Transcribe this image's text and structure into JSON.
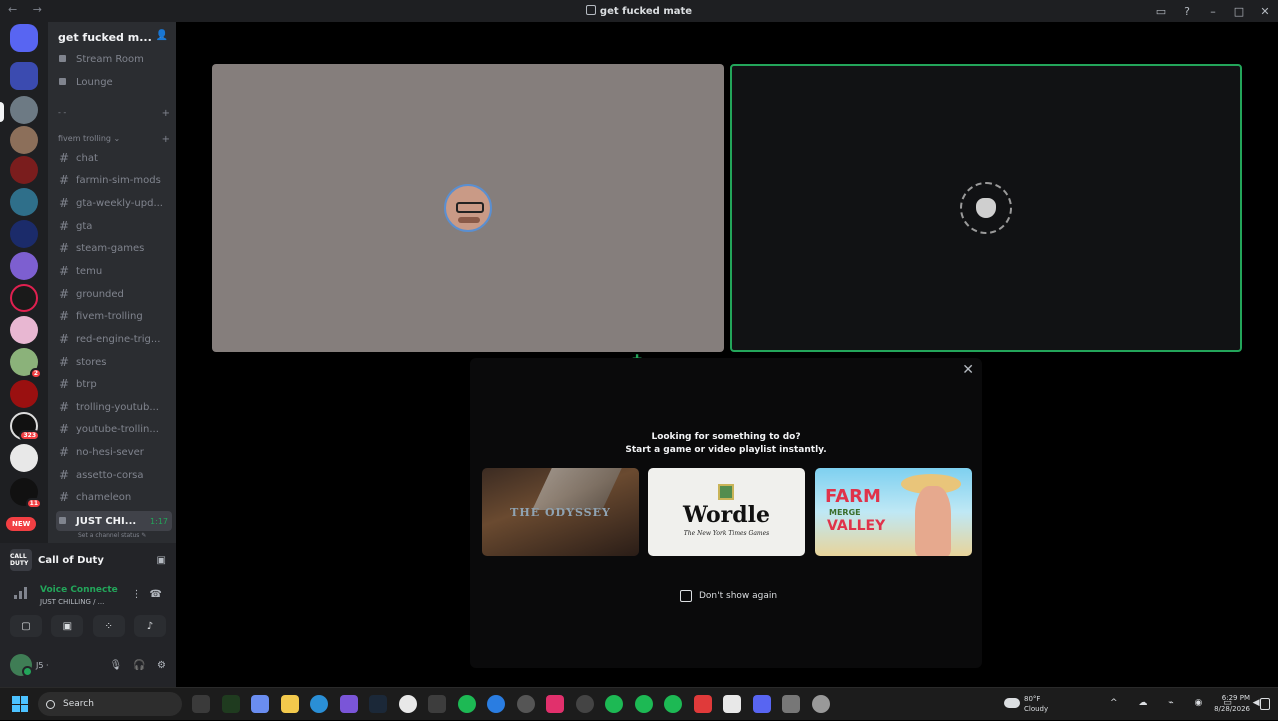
{
  "window": {
    "title": "get fucked mate",
    "nav_glyphs": "← →",
    "controls": [
      "▭",
      "?",
      "–",
      "□",
      "✕"
    ]
  },
  "server": {
    "name": "get fucked m...",
    "voice_channels": [
      {
        "label": "Stream Room"
      },
      {
        "label": "Lounge"
      }
    ],
    "blank_category": {
      "label": "- -",
      "plus": "+"
    },
    "category": {
      "label": "fivem trolling ⌄",
      "plus": "+"
    },
    "text_channels": [
      {
        "label": "chat"
      },
      {
        "label": "farmin-sim-mods"
      },
      {
        "label": "gta-weekly-upd..."
      },
      {
        "label": "gta"
      },
      {
        "label": "steam-games"
      },
      {
        "label": "temu"
      },
      {
        "label": "grounded"
      },
      {
        "label": "fivem-trolling"
      },
      {
        "label": "red-engine-trig..."
      },
      {
        "label": "stores"
      },
      {
        "label": "btrp"
      },
      {
        "label": "trolling-youtub..."
      },
      {
        "label": "youtube-trollin..."
      },
      {
        "label": "no-hesi-sever"
      },
      {
        "label": "assetto-corsa"
      },
      {
        "label": "chameleon"
      }
    ],
    "active_voice": {
      "label": "JUST CHI...",
      "time": "1:17",
      "status_hint": "Set a channel status ✎"
    }
  },
  "guild_badges": {
    "g1": "2",
    "g2": "323",
    "g3": "11",
    "new": "NEW"
  },
  "activity": {
    "icon_text": "CALL DUTY",
    "name": "Call of Duty"
  },
  "voice_connection": {
    "title": "Voice Connecte",
    "subtitle": "JUST CHILLING / ..."
  },
  "user": {
    "name": "J5 ·",
    "icons": [
      "🎙",
      "🎧",
      "⚙"
    ]
  },
  "popup": {
    "line1": "Looking for something to do?",
    "line2": "Start a game or video playlist instantly.",
    "close": "✕",
    "cards": {
      "odyssey": "THE ODYSSEY",
      "wordle": "Wordle",
      "wordle_sub": "The New York Times Games",
      "farm_1": "FARM",
      "farm_2": "MERGE",
      "farm_3": "VALLEY"
    },
    "dont_show": "Don't show again"
  },
  "taskbar": {
    "search_placeholder": "Search",
    "weather_temp": "80°F",
    "weather_cond": "Cloudy",
    "time": "6:29 PM",
    "date": "8/28/2026",
    "tray_icons": "^ ☁ ⌁ ◉ ▭ ◀"
  },
  "colors": {
    "green": "#23a55a",
    "sidebar": "#2b2d31",
    "rail": "#1e1f22",
    "tile_a": "#857e7c"
  }
}
